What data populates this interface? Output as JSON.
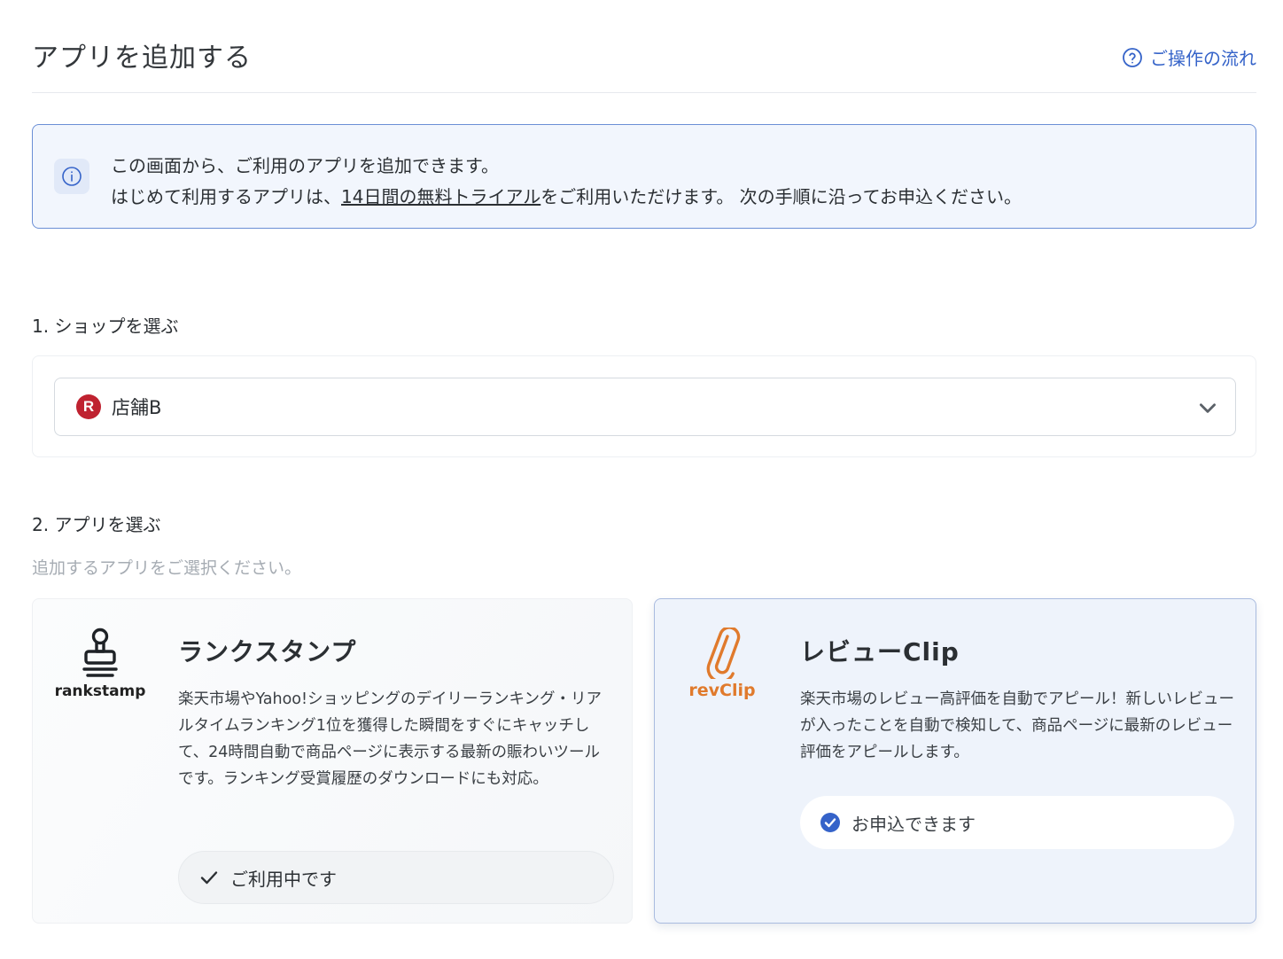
{
  "header": {
    "title": "アプリを追加する",
    "help_link": "ご操作の流れ"
  },
  "info": {
    "line1": "この画面から、ご利用のアプリを追加できます。",
    "line2_prefix": "はじめて利用するアプリは、",
    "line2_link": "14日間の無料トライアル",
    "line2_suffix": "をご利用いただけます。 次の手順に沿ってお申込ください。"
  },
  "step1": {
    "label": "1. ショップを選ぶ",
    "selected_shop": "店舗B",
    "shop_icon_letter": "R"
  },
  "step2": {
    "label": "2. アプリを選ぶ",
    "hint": "追加するアプリをご選択ください。"
  },
  "apps": [
    {
      "logo_text": "rankstamp",
      "title": "ランクスタンプ",
      "description": "楽天市場やYahoo!ショッピングのデイリーランキング・リアルタイムランキング1位を獲得した瞬間をすぐにキャッチして、24時間自動で商品ページに表示する最新の賑わいツールです。ランキング受賞履歴のダウンロードにも対応。",
      "status": "ご利用中です",
      "status_icon": "check-icon"
    },
    {
      "logo_text": "revClip",
      "title": "レビューClip",
      "description": "楽天市場のレビュー高評価を自動でアピール！新しいレビューが入ったことを自動で検知して、商品ページに最新のレビュー評価をアピールします。",
      "status": "お申込できます",
      "status_icon": "check-circle-icon"
    }
  ],
  "colors": {
    "accent": "#3563c9",
    "info_border": "#6b8fd6",
    "rakuten_red": "#bf2230",
    "revclip_orange": "#e07a2c"
  }
}
